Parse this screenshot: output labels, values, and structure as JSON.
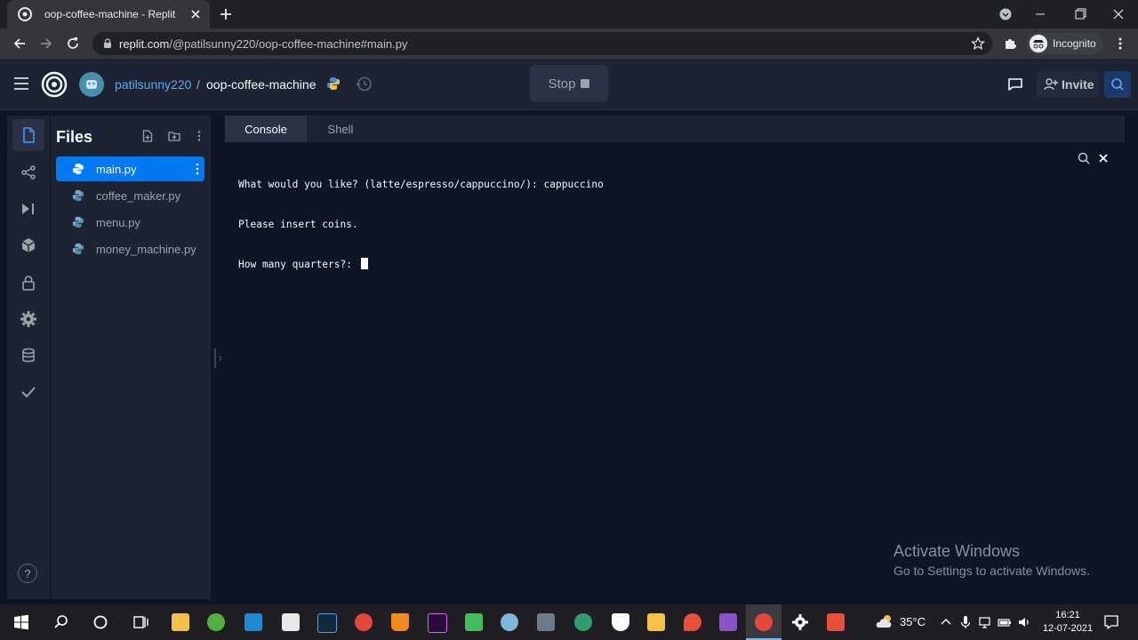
{
  "browser": {
    "tab_title": "oop-coffee-machine - Replit",
    "url_host": "replit.com",
    "url_path": "/@patilsunny220/oop-coffee-machine#main.py",
    "profile_label": "Incognito"
  },
  "header": {
    "username": "patilsunny220",
    "separator": "/",
    "repl_name": "oop-coffee-machine",
    "stop_label": "Stop",
    "invite_label": "Invite"
  },
  "files": {
    "title": "Files",
    "items": [
      {
        "name": "main.py",
        "selected": true
      },
      {
        "name": "coffee_maker.py"
      },
      {
        "name": "menu.py"
      },
      {
        "name": "money_machine.py"
      }
    ]
  },
  "console": {
    "tabs": [
      "Console",
      "Shell"
    ],
    "lines": [
      "What would you like? (latte/espresso/cappuccino/): cappuccino",
      "Please insert coins.",
      "How many quarters?: "
    ]
  },
  "help_label": "?",
  "watermark": {
    "line1": "Activate Windows",
    "line2": "Go to Settings to activate Windows."
  },
  "taskbar": {
    "weather": "35°C",
    "time": "16:21",
    "date": "12-07-2021"
  },
  "colors": {
    "accent": "#0079f2",
    "username": "#5da9f5",
    "background": "#0e1525",
    "panel": "#1c2333"
  }
}
